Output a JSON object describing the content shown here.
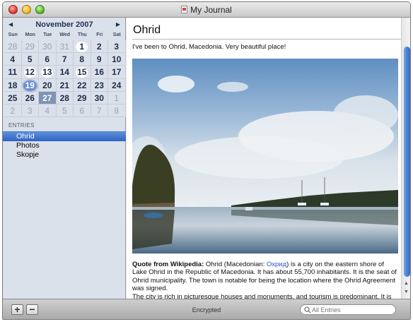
{
  "window": {
    "title": "My Journal"
  },
  "calendar": {
    "month_label": "November 2007",
    "prev_icon": "triangle-left",
    "next_icon": "triangle-right",
    "weekdays": [
      "Sun",
      "Mon",
      "Tue",
      "Wed",
      "Thu",
      "Fri",
      "Sat"
    ],
    "weeks": [
      [
        "28",
        "29",
        "30",
        "31",
        "1",
        "2",
        "3"
      ],
      [
        "4",
        "5",
        "6",
        "7",
        "8",
        "9",
        "10"
      ],
      [
        "11",
        "12",
        "13",
        "14",
        "15",
        "16",
        "17"
      ],
      [
        "18",
        "19",
        "20",
        "21",
        "22",
        "23",
        "24"
      ],
      [
        "25",
        "26",
        "27",
        "28",
        "29",
        "30",
        "1"
      ],
      [
        "2",
        "3",
        "4",
        "5",
        "6",
        "7",
        "8"
      ]
    ],
    "highlighted_days": [
      "1",
      "12",
      "13",
      "15",
      "19"
    ],
    "selected_day": "19",
    "today_day": "27"
  },
  "entries": {
    "header": "ENTRIES",
    "items": [
      {
        "label": "Ohrid",
        "selected": true
      },
      {
        "label": "Photos",
        "selected": false
      },
      {
        "label": "Skopje",
        "selected": false
      }
    ]
  },
  "entry": {
    "title": "Ohrid",
    "body": "I've been to Ohrid, Macedonia. Very beautiful place!",
    "quote_label": "Quote from Wikipedia:",
    "quote_pre": " Ohrid (Macedonian: ",
    "quote_link": "Охрид",
    "quote_post": ") is a city on the eastern shore of Lake Ohrid in the Republic of Macedonia. It has about 55,700 inhabitants. It is the seat of Ohrid municipality. The town is notable for being the location where the Ohrid Agreement was signed.",
    "quote_more": "The city is rich in picturesque houses and monuments, and tourism is predominant. It is"
  },
  "bottom": {
    "add_label": "+",
    "remove_label": "−",
    "status": "Encrypted",
    "search_placeholder": "All Entries"
  },
  "colors": {
    "accent": "#2d62c4",
    "sidebar_bg": "#dbe1ea",
    "link": "#2a52c8"
  }
}
